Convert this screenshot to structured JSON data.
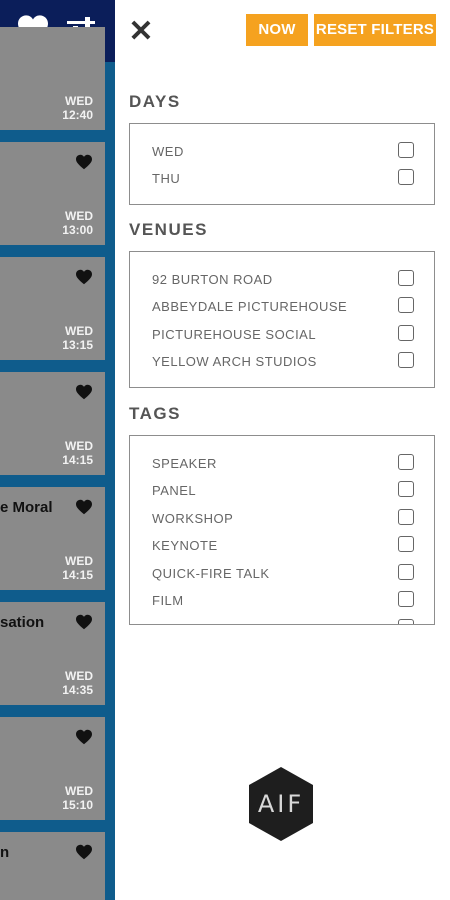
{
  "left_list": {
    "cards": [
      {
        "title": "",
        "day": "WED",
        "time": "12:40",
        "favorited": false
      },
      {
        "title": "",
        "day": "WED",
        "time": "13:00",
        "favorited": true
      },
      {
        "title": "",
        "day": "WED",
        "time": "13:15",
        "favorited": true
      },
      {
        "title": "",
        "day": "WED",
        "time": "14:15",
        "favorited": true
      },
      {
        "title": "e Moral",
        "day": "WED",
        "time": "14:15",
        "favorited": true
      },
      {
        "title": "sation",
        "day": "WED",
        "time": "14:35",
        "favorited": true
      },
      {
        "title": "",
        "day": "WED",
        "time": "15:10",
        "favorited": true
      },
      {
        "title": "n",
        "day": "",
        "time": "",
        "favorited": true
      }
    ]
  },
  "toolbar": {
    "now_label": "NOW",
    "reset_label": "RESET FILTERS",
    "close_icon": "close-icon"
  },
  "sections": {
    "days": {
      "title": "DAYS",
      "options": [
        "WED",
        "THU"
      ]
    },
    "venues": {
      "title": "VENUES",
      "options": [
        "92 BURTON ROAD",
        "ABBEYDALE PICTUREHOUSE",
        "PICTUREHOUSE SOCIAL",
        "YELLOW ARCH STUDIOS"
      ]
    },
    "tags": {
      "title": "TAGS",
      "options": [
        "SPEAKER",
        "PANEL",
        "WORKSHOP",
        "KEYNOTE",
        "QUICK-FIRE TALK",
        "FILM"
      ]
    }
  },
  "logo": {
    "text": "AIF"
  },
  "colors": {
    "accent": "#f5a21f",
    "nav_bg": "#0b1e5a",
    "strip_bg": "#0f5c8c",
    "card_bg": "#8a8a8a"
  }
}
